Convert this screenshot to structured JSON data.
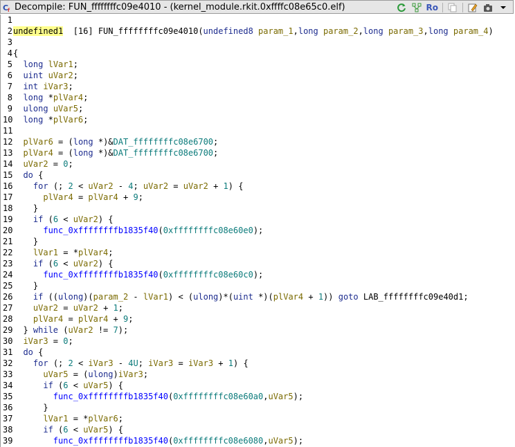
{
  "window": {
    "title": "Decompile: FUN_ffffffffc09e4010 - (kernel_module.rkit.0xffffc08e65c0.elf)",
    "toolbar": {
      "ro_label": "Ro"
    }
  },
  "code_lines": [
    {
      "n": "1",
      "t": []
    },
    {
      "n": "2",
      "t": [
        [
          "hl",
          "undefined1"
        ],
        [
          "p",
          "  [16] FUN_ffffffffc09e4010("
        ],
        [
          "kw",
          "undefined8"
        ],
        [
          "p",
          " "
        ],
        [
          "var",
          "param_1"
        ],
        [
          "p",
          ","
        ],
        [
          "kw",
          "long"
        ],
        [
          "p",
          " "
        ],
        [
          "var",
          "param_2"
        ],
        [
          "p",
          ","
        ],
        [
          "kw",
          "long"
        ],
        [
          "p",
          " "
        ],
        [
          "var",
          "param_3"
        ],
        [
          "p",
          ","
        ],
        [
          "kw",
          "long"
        ],
        [
          "p",
          " "
        ],
        [
          "var",
          "param_4"
        ],
        [
          "p",
          ")"
        ]
      ]
    },
    {
      "n": "3",
      "t": []
    },
    {
      "n": "4",
      "t": [
        [
          "p",
          "{"
        ]
      ]
    },
    {
      "n": "5",
      "t": [
        [
          "p",
          "  "
        ],
        [
          "kw",
          "long"
        ],
        [
          "p",
          " "
        ],
        [
          "var",
          "lVar1"
        ],
        [
          "p",
          ";"
        ]
      ]
    },
    {
      "n": "6",
      "t": [
        [
          "p",
          "  "
        ],
        [
          "kw",
          "uint"
        ],
        [
          "p",
          " "
        ],
        [
          "var",
          "uVar2"
        ],
        [
          "p",
          ";"
        ]
      ]
    },
    {
      "n": "7",
      "t": [
        [
          "p",
          "  "
        ],
        [
          "kw",
          "int"
        ],
        [
          "p",
          " "
        ],
        [
          "var",
          "iVar3"
        ],
        [
          "p",
          ";"
        ]
      ]
    },
    {
      "n": "8",
      "t": [
        [
          "p",
          "  "
        ],
        [
          "kw",
          "long"
        ],
        [
          "p",
          " *"
        ],
        [
          "var",
          "plVar4"
        ],
        [
          "p",
          ";"
        ]
      ]
    },
    {
      "n": "9",
      "t": [
        [
          "p",
          "  "
        ],
        [
          "kw",
          "ulong"
        ],
        [
          "p",
          " "
        ],
        [
          "var",
          "uVar5"
        ],
        [
          "p",
          ";"
        ]
      ]
    },
    {
      "n": "10",
      "t": [
        [
          "p",
          "  "
        ],
        [
          "kw",
          "long"
        ],
        [
          "p",
          " *"
        ],
        [
          "var",
          "plVar6"
        ],
        [
          "p",
          ";"
        ]
      ]
    },
    {
      "n": "11",
      "t": []
    },
    {
      "n": "12",
      "t": [
        [
          "p",
          "  "
        ],
        [
          "var",
          "plVar6"
        ],
        [
          "p",
          " = ("
        ],
        [
          "kw",
          "long"
        ],
        [
          "p",
          " *)&"
        ],
        [
          "dat",
          "DAT_ffffffffc08e6700"
        ],
        [
          "p",
          ";"
        ]
      ]
    },
    {
      "n": "13",
      "t": [
        [
          "p",
          "  "
        ],
        [
          "var",
          "plVar4"
        ],
        [
          "p",
          " = ("
        ],
        [
          "kw",
          "long"
        ],
        [
          "p",
          " *)&"
        ],
        [
          "dat",
          "DAT_ffffffffc08e6700"
        ],
        [
          "p",
          ";"
        ]
      ]
    },
    {
      "n": "14",
      "t": [
        [
          "p",
          "  "
        ],
        [
          "var",
          "uVar2"
        ],
        [
          "p",
          " = "
        ],
        [
          "num",
          "0"
        ],
        [
          "p",
          ";"
        ]
      ]
    },
    {
      "n": "15",
      "t": [
        [
          "p",
          "  "
        ],
        [
          "kw",
          "do"
        ],
        [
          "p",
          " {"
        ]
      ]
    },
    {
      "n": "16",
      "t": [
        [
          "p",
          "    "
        ],
        [
          "kw",
          "for"
        ],
        [
          "p",
          " (; "
        ],
        [
          "num",
          "2"
        ],
        [
          "p",
          " < "
        ],
        [
          "var",
          "uVar2"
        ],
        [
          "p",
          " - "
        ],
        [
          "num",
          "4"
        ],
        [
          "p",
          "; "
        ],
        [
          "var",
          "uVar2"
        ],
        [
          "p",
          " = "
        ],
        [
          "var",
          "uVar2"
        ],
        [
          "p",
          " + "
        ],
        [
          "num",
          "1"
        ],
        [
          "p",
          ") {"
        ]
      ]
    },
    {
      "n": "17",
      "t": [
        [
          "p",
          "      "
        ],
        [
          "var",
          "plVar4"
        ],
        [
          "p",
          " = "
        ],
        [
          "var",
          "plVar4"
        ],
        [
          "p",
          " + "
        ],
        [
          "num",
          "9"
        ],
        [
          "p",
          ";"
        ]
      ]
    },
    {
      "n": "18",
      "t": [
        [
          "p",
          "    }"
        ]
      ]
    },
    {
      "n": "19",
      "t": [
        [
          "p",
          "    "
        ],
        [
          "kw",
          "if"
        ],
        [
          "p",
          " ("
        ],
        [
          "num",
          "6"
        ],
        [
          "p",
          " < "
        ],
        [
          "var",
          "uVar2"
        ],
        [
          "p",
          ") {"
        ]
      ]
    },
    {
      "n": "20",
      "t": [
        [
          "p",
          "      "
        ],
        [
          "fn",
          "func_0xffffffffb1835f40"
        ],
        [
          "p",
          "("
        ],
        [
          "num",
          "0xffffffffc08e60e0"
        ],
        [
          "p",
          ");"
        ]
      ]
    },
    {
      "n": "21",
      "t": [
        [
          "p",
          "    }"
        ]
      ]
    },
    {
      "n": "22",
      "t": [
        [
          "p",
          "    "
        ],
        [
          "var",
          "lVar1"
        ],
        [
          "p",
          " = *"
        ],
        [
          "var",
          "plVar4"
        ],
        [
          "p",
          ";"
        ]
      ]
    },
    {
      "n": "23",
      "t": [
        [
          "p",
          "    "
        ],
        [
          "kw",
          "if"
        ],
        [
          "p",
          " ("
        ],
        [
          "num",
          "6"
        ],
        [
          "p",
          " < "
        ],
        [
          "var",
          "uVar2"
        ],
        [
          "p",
          ") {"
        ]
      ]
    },
    {
      "n": "24",
      "t": [
        [
          "p",
          "      "
        ],
        [
          "fn",
          "func_0xffffffffb1835f40"
        ],
        [
          "p",
          "("
        ],
        [
          "num",
          "0xffffffffc08e60c0"
        ],
        [
          "p",
          ");"
        ]
      ]
    },
    {
      "n": "25",
      "t": [
        [
          "p",
          "    }"
        ]
      ]
    },
    {
      "n": "26",
      "t": [
        [
          "p",
          "    "
        ],
        [
          "kw",
          "if"
        ],
        [
          "p",
          " (("
        ],
        [
          "kw",
          "ulong"
        ],
        [
          "p",
          ")("
        ],
        [
          "var",
          "param_2"
        ],
        [
          "p",
          " - "
        ],
        [
          "var",
          "lVar1"
        ],
        [
          "p",
          ") < ("
        ],
        [
          "kw",
          "ulong"
        ],
        [
          "p",
          ")*("
        ],
        [
          "kw",
          "uint"
        ],
        [
          "p",
          " *)("
        ],
        [
          "var",
          "plVar4"
        ],
        [
          "p",
          " + "
        ],
        [
          "num",
          "1"
        ],
        [
          "p",
          ")) "
        ],
        [
          "kw",
          "goto"
        ],
        [
          "p",
          " LAB_ffffffffc09e40d1;"
        ]
      ]
    },
    {
      "n": "27",
      "t": [
        [
          "p",
          "    "
        ],
        [
          "var",
          "uVar2"
        ],
        [
          "p",
          " = "
        ],
        [
          "var",
          "uVar2"
        ],
        [
          "p",
          " + "
        ],
        [
          "num",
          "1"
        ],
        [
          "p",
          ";"
        ]
      ]
    },
    {
      "n": "28",
      "t": [
        [
          "p",
          "    "
        ],
        [
          "var",
          "plVar4"
        ],
        [
          "p",
          " = "
        ],
        [
          "var",
          "plVar4"
        ],
        [
          "p",
          " + "
        ],
        [
          "num",
          "9"
        ],
        [
          "p",
          ";"
        ]
      ]
    },
    {
      "n": "29",
      "t": [
        [
          "p",
          "  } "
        ],
        [
          "kw",
          "while"
        ],
        [
          "p",
          " ("
        ],
        [
          "var",
          "uVar2"
        ],
        [
          "p",
          " != "
        ],
        [
          "num",
          "7"
        ],
        [
          "p",
          ");"
        ]
      ]
    },
    {
      "n": "30",
      "t": [
        [
          "p",
          "  "
        ],
        [
          "var",
          "iVar3"
        ],
        [
          "p",
          " = "
        ],
        [
          "num",
          "0"
        ],
        [
          "p",
          ";"
        ]
      ]
    },
    {
      "n": "31",
      "t": [
        [
          "p",
          "  "
        ],
        [
          "kw",
          "do"
        ],
        [
          "p",
          " {"
        ]
      ]
    },
    {
      "n": "32",
      "t": [
        [
          "p",
          "    "
        ],
        [
          "kw",
          "for"
        ],
        [
          "p",
          " (; "
        ],
        [
          "num",
          "2"
        ],
        [
          "p",
          " < "
        ],
        [
          "var",
          "iVar3"
        ],
        [
          "p",
          " - "
        ],
        [
          "num",
          "4U"
        ],
        [
          "p",
          "; "
        ],
        [
          "var",
          "iVar3"
        ],
        [
          "p",
          " = "
        ],
        [
          "var",
          "iVar3"
        ],
        [
          "p",
          " + "
        ],
        [
          "num",
          "1"
        ],
        [
          "p",
          ") {"
        ]
      ]
    },
    {
      "n": "33",
      "t": [
        [
          "p",
          "      "
        ],
        [
          "var",
          "uVar5"
        ],
        [
          "p",
          " = ("
        ],
        [
          "kw",
          "ulong"
        ],
        [
          "p",
          ")"
        ],
        [
          "var",
          "iVar3"
        ],
        [
          "p",
          ";"
        ]
      ]
    },
    {
      "n": "34",
      "t": [
        [
          "p",
          "      "
        ],
        [
          "kw",
          "if"
        ],
        [
          "p",
          " ("
        ],
        [
          "num",
          "6"
        ],
        [
          "p",
          " < "
        ],
        [
          "var",
          "uVar5"
        ],
        [
          "p",
          ") {"
        ]
      ]
    },
    {
      "n": "35",
      "t": [
        [
          "p",
          "        "
        ],
        [
          "fn",
          "func_0xffffffffb1835f40"
        ],
        [
          "p",
          "("
        ],
        [
          "num",
          "0xffffffffc08e60a0"
        ],
        [
          "p",
          ","
        ],
        [
          "var",
          "uVar5"
        ],
        [
          "p",
          ");"
        ]
      ]
    },
    {
      "n": "36",
      "t": [
        [
          "p",
          "      }"
        ]
      ]
    },
    {
      "n": "37",
      "t": [
        [
          "p",
          "      "
        ],
        [
          "var",
          "lVar1"
        ],
        [
          "p",
          " = *"
        ],
        [
          "var",
          "plVar6"
        ],
        [
          "p",
          ";"
        ]
      ]
    },
    {
      "n": "38",
      "t": [
        [
          "p",
          "      "
        ],
        [
          "kw",
          "if"
        ],
        [
          "p",
          " ("
        ],
        [
          "num",
          "6"
        ],
        [
          "p",
          " < "
        ],
        [
          "var",
          "uVar5"
        ],
        [
          "p",
          ") {"
        ]
      ]
    },
    {
      "n": "39",
      "t": [
        [
          "p",
          "        "
        ],
        [
          "fn",
          "func_0xffffffffb1835f40"
        ],
        [
          "p",
          "("
        ],
        [
          "num",
          "0xffffffffc08e6080"
        ],
        [
          "p",
          ","
        ],
        [
          "var",
          "uVar5"
        ],
        [
          "p",
          ");"
        ]
      ]
    }
  ]
}
